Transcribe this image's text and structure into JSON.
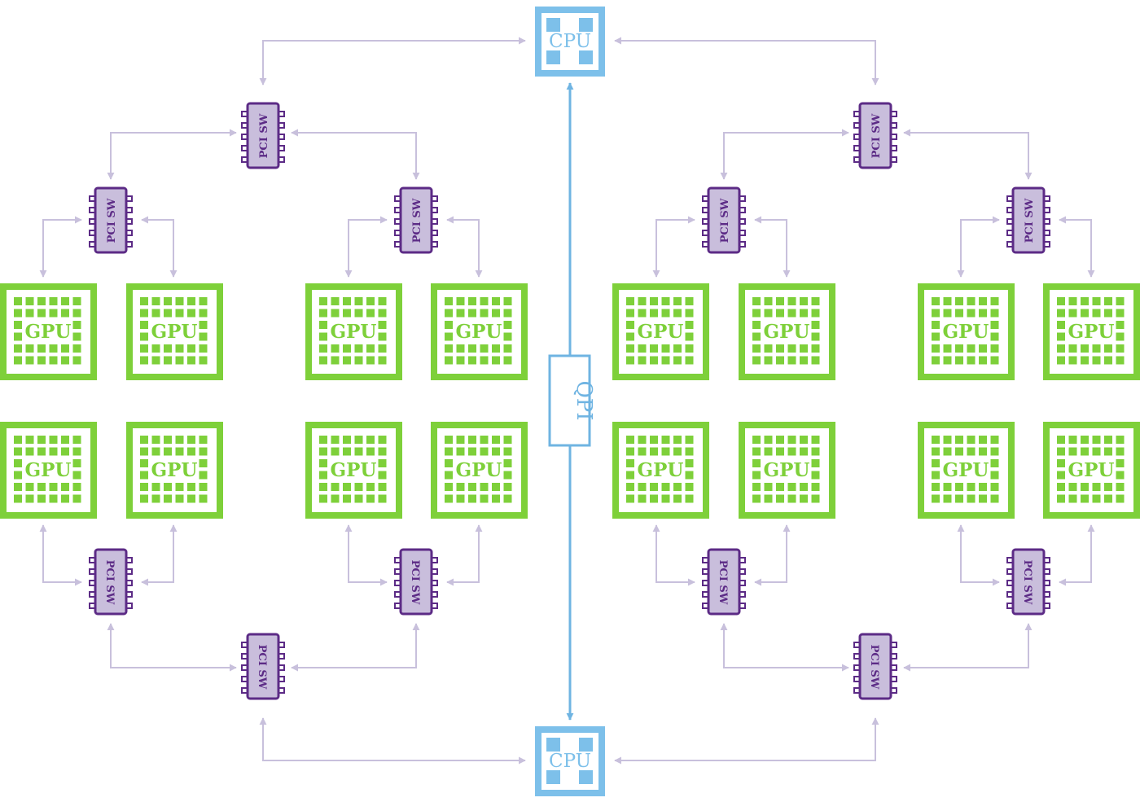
{
  "labels": {
    "cpu": "CPU",
    "gpu": "GPU",
    "switch": "PCI SW",
    "qpi": "QPI"
  },
  "colors": {
    "cpu": "#7dc0ea",
    "gpu": "#7ed03a",
    "switch_fill": "#c9bedc",
    "switch_border": "#5c2b86",
    "switch_text": "#5c2b86",
    "link": "#c8c0dc",
    "qpi": "#6fb4e2"
  },
  "topology": {
    "cpus": 2,
    "root_switches_per_cpu": 2,
    "leaf_switches_per_root": 2,
    "gpus_per_leaf_switch": 2,
    "gpus_total": 16
  }
}
